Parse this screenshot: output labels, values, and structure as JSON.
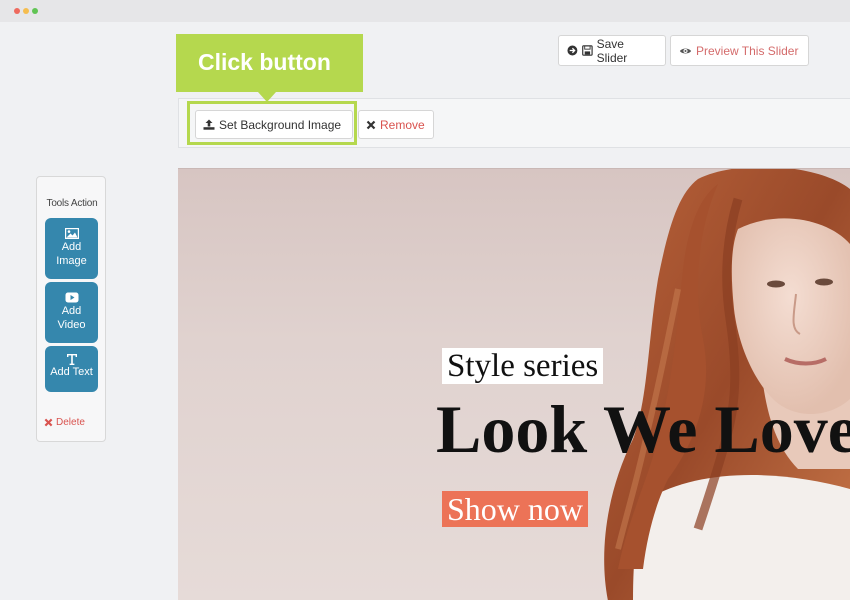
{
  "window": {
    "controls": [
      "close",
      "minimize",
      "maximize"
    ]
  },
  "header": {
    "save_label": "Save Slider",
    "preview_label": "Preview This Slider"
  },
  "callout": {
    "text": "Click button"
  },
  "toolbar": {
    "set_bg_label": "Set Background Image",
    "remove_label": "Remove"
  },
  "tools": {
    "title": "Tools Action",
    "add_image_line1": "Add",
    "add_image_line2": "Image",
    "add_video_line1": "Add",
    "add_video_line2": "Video",
    "add_text_label": "Add Text",
    "delete_label": "Delete"
  },
  "slide": {
    "tag": "Style series",
    "headline": "Look We Love",
    "cta": "Show now"
  },
  "colors": {
    "accent_green": "#b5d84e",
    "tool_blue": "#3587ad",
    "danger_red": "#d9534f",
    "cta_orange": "#ec7357"
  }
}
